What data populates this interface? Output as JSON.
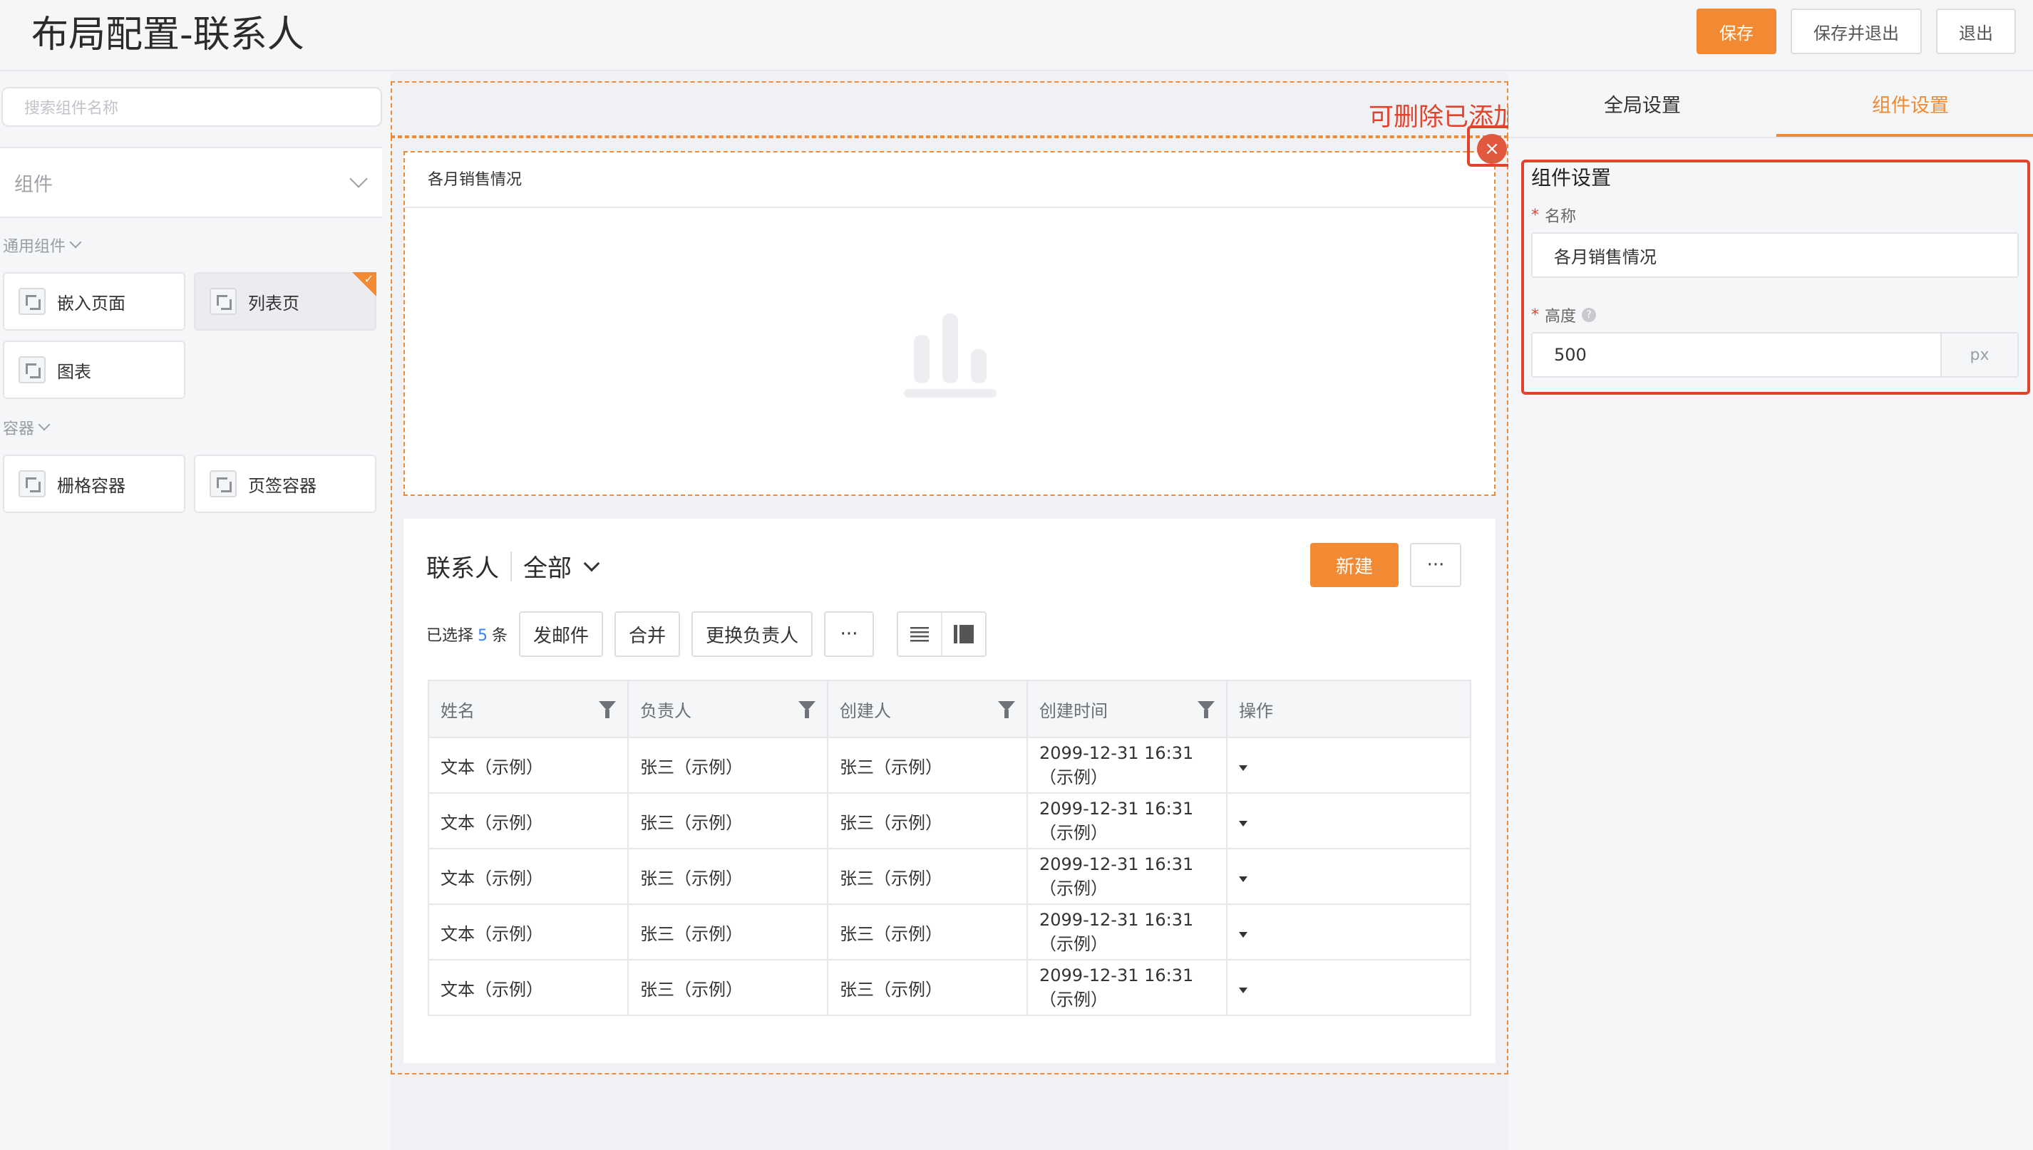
{
  "header": {
    "title": "布局配置-联系人",
    "save_label": "保存",
    "save_exit_label": "保存并退出",
    "exit_label": "退出"
  },
  "left": {
    "search_placeholder": "搜索组件名称",
    "component_select_label": "组件",
    "groups": [
      {
        "title": "通用组件",
        "items": [
          {
            "label": "嵌入页面"
          },
          {
            "label": "列表页"
          },
          {
            "label": "图表"
          }
        ]
      },
      {
        "title": "容器",
        "items": [
          {
            "label": "栅格容器"
          },
          {
            "label": "页签容器"
          }
        ]
      }
    ]
  },
  "canvas": {
    "chart_card_title": "各月销售情况",
    "close_glyph": "×",
    "list": {
      "title": "联系人",
      "view": "全部",
      "new_label": "新建",
      "more_glyph": "···",
      "selected_prefix": "已选择",
      "selected_count": "5",
      "selected_suffix": "条",
      "actions": [
        "发邮件",
        "合并",
        "更换负责人",
        "···"
      ],
      "columns": [
        "姓名",
        "负责人",
        "创建人",
        "创建时间",
        "操作"
      ],
      "rows": [
        [
          "文本（示例）",
          "张三（示例）",
          "张三（示例）",
          "2099-12-31 16:31（示例）"
        ],
        [
          "文本（示例）",
          "张三（示例）",
          "张三（示例）",
          "2099-12-31 16:31（示例）"
        ],
        [
          "文本（示例）",
          "张三（示例）",
          "张三（示例）",
          "2099-12-31 16:31（示例）"
        ],
        [
          "文本（示例）",
          "张三（示例）",
          "张三（示例）",
          "2099-12-31 16:31（示例）"
        ],
        [
          "文本（示例）",
          "张三（示例）",
          "张三（示例）",
          "2099-12-31 16:31（示例）"
        ]
      ]
    }
  },
  "annotation": "可删除已添加的组件",
  "right": {
    "tab_global": "全局设置",
    "tab_component": "组件设置",
    "section_title": "组件设置",
    "name_label": "名称",
    "name_value": "各月销售情况",
    "height_label": "高度",
    "height_value": "500",
    "height_unit": "px",
    "required_mark": "*",
    "help_glyph": "?"
  },
  "colors": {
    "accent": "#f18a32",
    "annotation_red": "#e2432c",
    "close_red": "#e2583e",
    "link_blue": "#3b82f6"
  },
  "icons": [
    "component-icon",
    "chevron-down-icon",
    "close-icon",
    "bar-chart-icon",
    "filter-icon",
    "caret-down-icon",
    "list-view-icon",
    "card-view-icon",
    "help-icon",
    "check-icon"
  ]
}
